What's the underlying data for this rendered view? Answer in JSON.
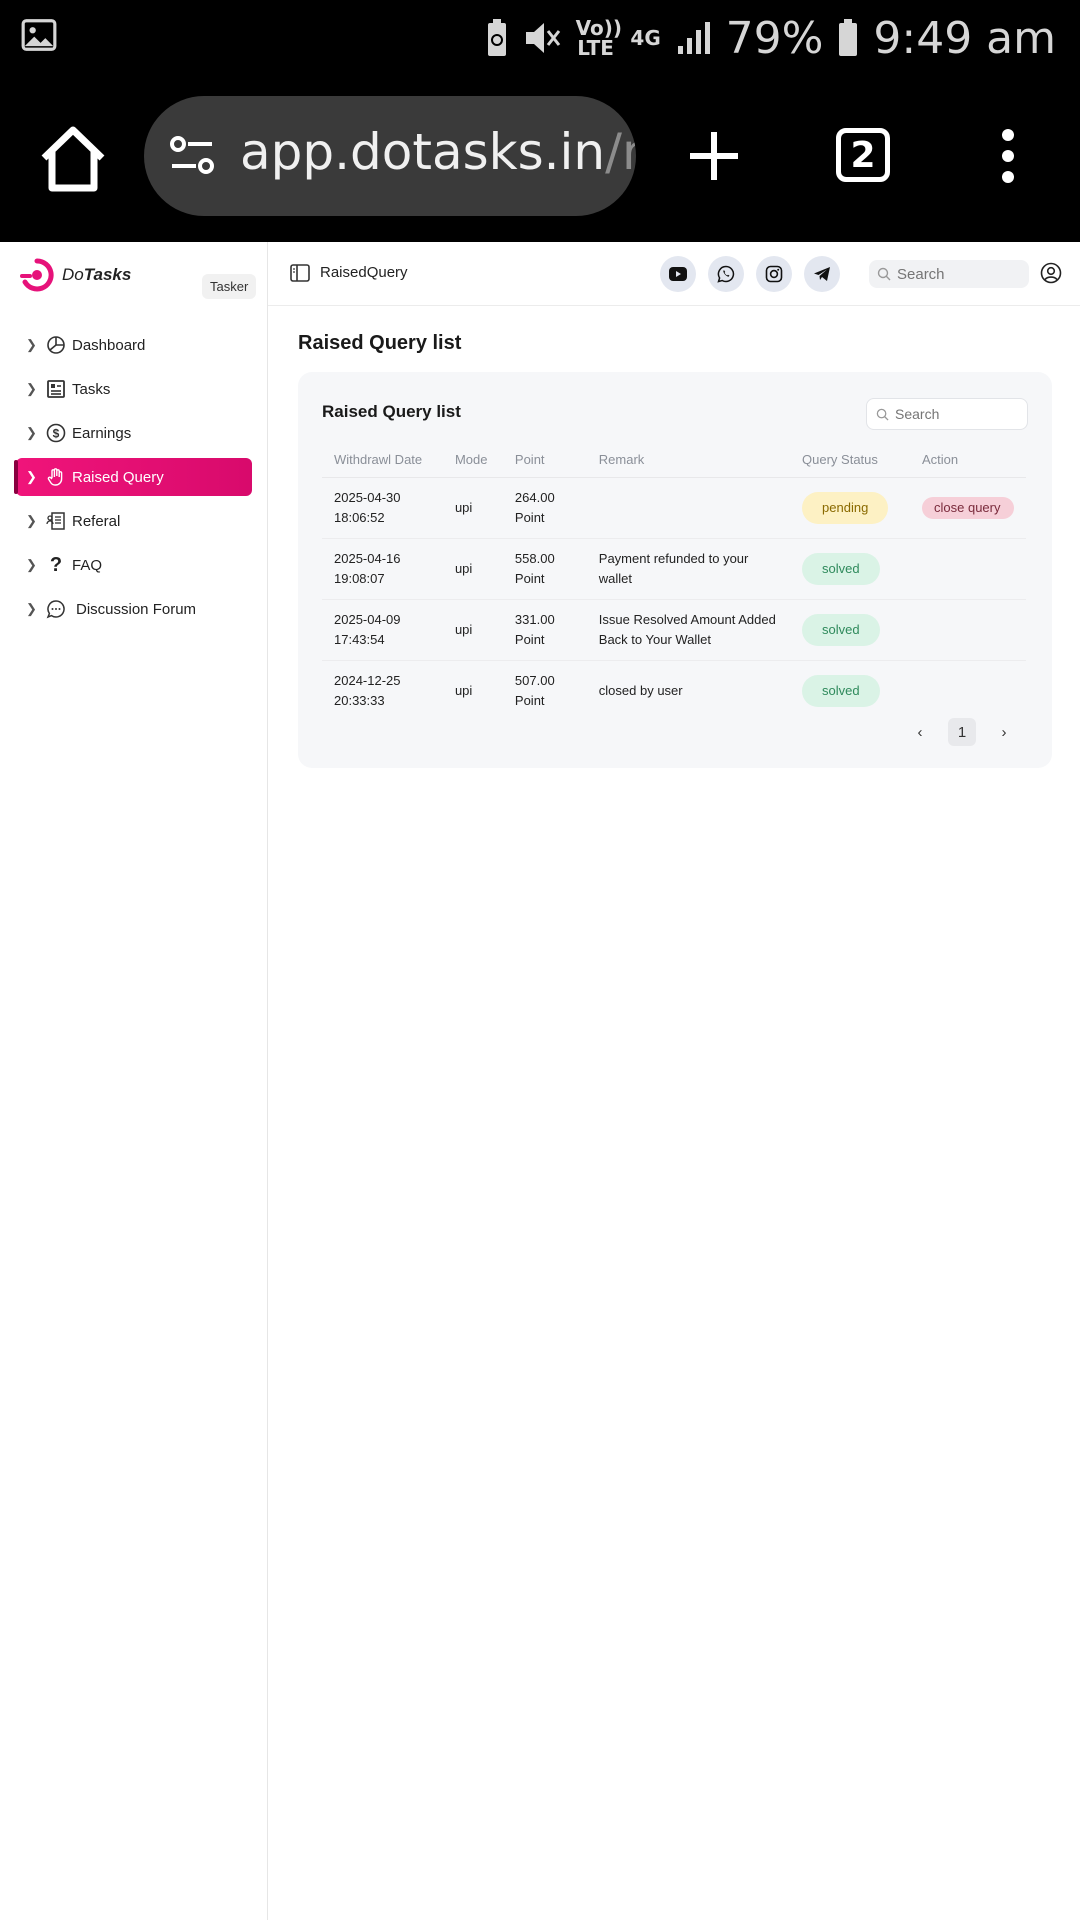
{
  "status_bar": {
    "signal": "Vo)) LTE",
    "network": "4G",
    "battery": "79%",
    "time": "9:49 am"
  },
  "browser": {
    "url_host": "app.dotasks.in",
    "url_path": "/ra",
    "tab_count": "2"
  },
  "brand": {
    "name_prefix": "Do",
    "name_suffix": "Tasks",
    "role": "Tasker",
    "accent": "#e6127a"
  },
  "sidebar": {
    "items": [
      {
        "label": "Dashboard",
        "icon": "pie-chart-icon"
      },
      {
        "label": "Tasks",
        "icon": "task-list-icon"
      },
      {
        "label": "Earnings",
        "icon": "dollar-icon"
      },
      {
        "label": "Raised Query",
        "icon": "hand-icon",
        "active": true
      },
      {
        "label": "Referal",
        "icon": "referral-icon"
      },
      {
        "label": "FAQ",
        "icon": "question-icon"
      },
      {
        "label": "Discussion Forum",
        "icon": "chat-icon"
      }
    ]
  },
  "topbar": {
    "breadcrumb": "RaisedQuery",
    "search_placeholder": "Search",
    "social": [
      "youtube-icon",
      "whatsapp-icon",
      "instagram-icon",
      "telegram-icon"
    ]
  },
  "page": {
    "title": "Raised Query list",
    "card_title": "Raised Query list",
    "search_placeholder": "Search"
  },
  "table": {
    "headers": [
      "Withdrawl Date",
      "Mode",
      "Point",
      "Remark",
      "Query Status",
      "Action"
    ],
    "rows": [
      {
        "date": "2025-04-30",
        "time": "18:06:52",
        "mode": "upi",
        "point": "264.00",
        "unit": "Point",
        "remark": "",
        "status": "pending",
        "action": "close query"
      },
      {
        "date": "2025-04-16",
        "time": "19:08:07",
        "mode": "upi",
        "point": "558.00",
        "unit": "Point",
        "remark": "Payment refunded to your wallet",
        "status": "solved",
        "action": ""
      },
      {
        "date": "2025-04-09",
        "time": "17:43:54",
        "mode": "upi",
        "point": "331.00",
        "unit": "Point",
        "remark": "Issue Resolved Amount Added Back to Your Wallet",
        "status": "solved",
        "action": ""
      },
      {
        "date": "2024-12-25",
        "time": "20:33:33",
        "mode": "upi",
        "point": "507.00",
        "unit": "Point",
        "remark": "closed by user",
        "status": "solved",
        "action": ""
      }
    ]
  },
  "pagination": {
    "current": "1"
  }
}
